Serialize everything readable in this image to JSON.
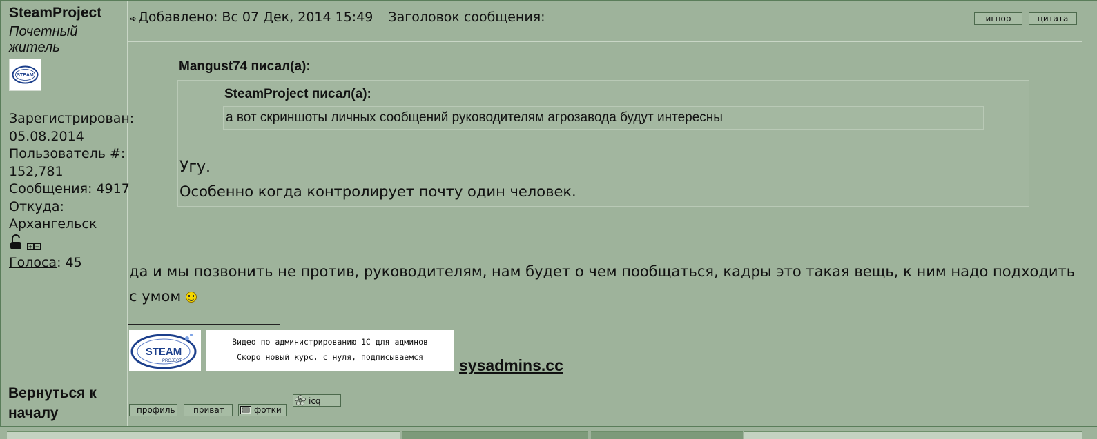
{
  "user": {
    "name": "SteamProject",
    "rank": "Почетный житель",
    "avatar_alt": "STEAM",
    "registered_label": "Зарегистрирован:",
    "registered_date": "05.08.2014",
    "user_no_label": "Пользователь #:",
    "user_no": "152,781",
    "posts": "Сообщения: 4917",
    "from_label": "Откуда:",
    "from": "Архангельск",
    "votes_label": "Голоса",
    "votes_value": ": 45"
  },
  "post": {
    "added": "Добавлено: Вс 07 Дек, 2014 15:49",
    "subject_label": "Заголовок сообщения:",
    "ignore_button": "игнор",
    "quote_button": "цитата",
    "quote_author": "Mangust74 писал(а):",
    "inner_quote_author": "SteamProject писал(а):",
    "inner_quote_text": "а вот скриншоты личных сообщений руководителям агрозавода будут интересны",
    "reply_line1": "Угу.",
    "reply_line2": "Особенно когда контролирует почту один человек.",
    "body_text": "да и мы позвонить не против, руководителям, нам будет о чем пообщаться, кадры это такая вещь, к ним надо подходить с умом",
    "signature": {
      "logo_text": "STEAM",
      "logo_subtext": "PROJECT",
      "banner_line1": "Видео по администрированию 1С для админов",
      "banner_line2": "Скоро новый курс, с нуля, подписываемся",
      "link_text": "sysadmins.cc"
    }
  },
  "footer": {
    "back_to_top": "Вернуться к началу",
    "profile_button": "профиль",
    "pm_button": "приват",
    "photos_button": "фотки",
    "icq_button": "icq"
  },
  "colors": {
    "background": "#9eb39b",
    "border": "#5a7d5a",
    "button_bg": "#a7bca4"
  }
}
